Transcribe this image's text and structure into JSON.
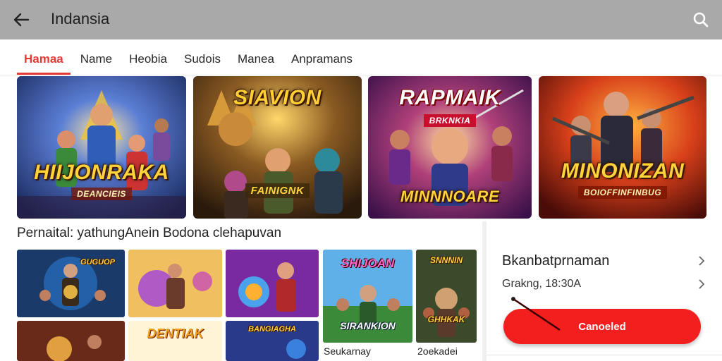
{
  "appbar": {
    "title": "Indansia",
    "back_icon": "arrow-left-icon",
    "search_icon": "search-icon"
  },
  "tabs": [
    {
      "label": "Hamaa",
      "active": true
    },
    {
      "label": "Name",
      "active": false
    },
    {
      "label": "Heobia",
      "active": false
    },
    {
      "label": "Sudois",
      "active": false
    },
    {
      "label": "Manea",
      "active": false
    },
    {
      "label": "Anpramans",
      "active": false
    }
  ],
  "featured": [
    {
      "title": "HIIJONRAKA",
      "subtitle": "DEANCIEIS"
    },
    {
      "title": "SIAVION",
      "subtitle": "FAINIGNK"
    },
    {
      "title": "RAPMAIK",
      "subtitle": "BRKNKIA",
      "footer": "MINNNOARE"
    },
    {
      "title": "MINONIZAN",
      "subtitle": "BOIOFFINFINBUG"
    }
  ],
  "section": {
    "title": "Pernaital: yathungAnein Bodona clehapuvan"
  },
  "grid": [
    {
      "title": "GUGUOP"
    },
    {
      "title": ""
    },
    {
      "title": ""
    },
    {
      "title": "SHIJOAN",
      "footer": "SIRANKION",
      "caption": "Seukarnay"
    },
    {
      "title": "SNNNIN",
      "footer": "GHHKAK",
      "caption": "2oekadei"
    },
    {
      "title": ""
    },
    {
      "title": "DENTIAK"
    },
    {
      "title": "BANGIAGHA"
    }
  ],
  "right_panel": {
    "title": "Bkanbatprnaman",
    "subtitle": "Grakng, 18:30A",
    "button_label": "Canoeled"
  },
  "colors": {
    "accent": "#e53935",
    "cta": "#f31f1f",
    "appbar": "#a9a9a9"
  }
}
